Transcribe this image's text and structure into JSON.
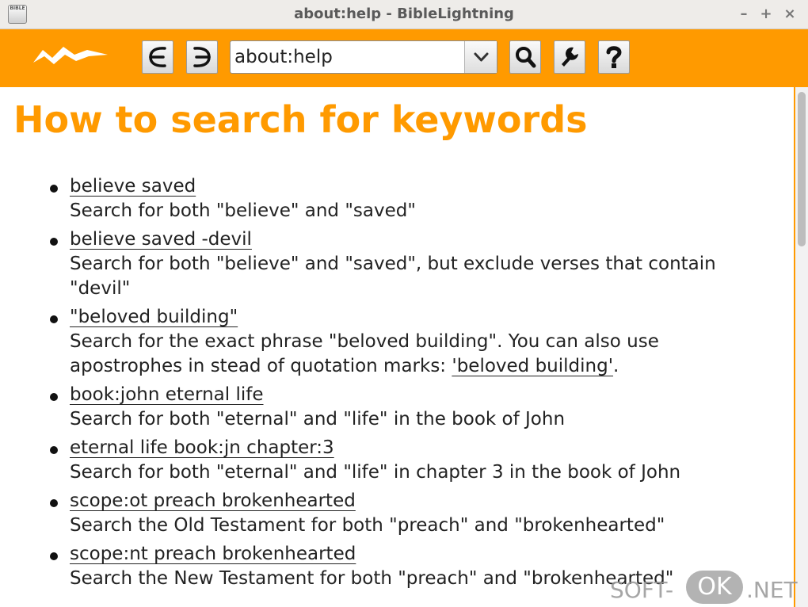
{
  "window": {
    "title": "about:help - BibleLightning",
    "app_icon_label": "BIBLE",
    "minimize": "–",
    "maximize": "+",
    "close": "×"
  },
  "toolbar": {
    "url": "about:help",
    "back_icon": "back-arrow-icon",
    "forward_icon": "forward-arrow-icon",
    "search_icon": "magnifier-icon",
    "settings_icon": "wrench-icon",
    "help_icon": "question-icon"
  },
  "page": {
    "heading": "How to search for keywords",
    "items": [
      {
        "query": "believe saved",
        "desc": "Search for both \"believe\" and \"saved\""
      },
      {
        "query": "believe saved -devil",
        "desc": "Search for both \"believe\" and \"saved\", but exclude verses that contain \"devil\""
      },
      {
        "query": "\"beloved building\"",
        "desc": "Search for the exact phrase \"beloved building\". You can also use apostrophes in stead of quotation marks: ",
        "desc_link": "'beloved building'",
        "desc_tail": "."
      },
      {
        "query": "book:john eternal life",
        "desc": "Search for both \"eternal\" and \"life\" in the book of John"
      },
      {
        "query": "eternal life book:jn chapter:3",
        "desc": "Search for both \"eternal\" and \"life\" in chapter 3 in the book of John"
      },
      {
        "query": "scope:ot preach brokenhearted",
        "desc": "Search the Old Testament for both \"preach\" and \"brokenhearted\""
      },
      {
        "query": "scope:nt preach brokenhearted",
        "desc": "Search the New Testament for both \"preach\" and \"brokenhearted\""
      }
    ]
  },
  "watermark": {
    "a": "SOFT-",
    "b": "OK",
    "c": ".NET"
  },
  "colors": {
    "accent": "#ff9a00",
    "titlebar": "#eeece9"
  }
}
